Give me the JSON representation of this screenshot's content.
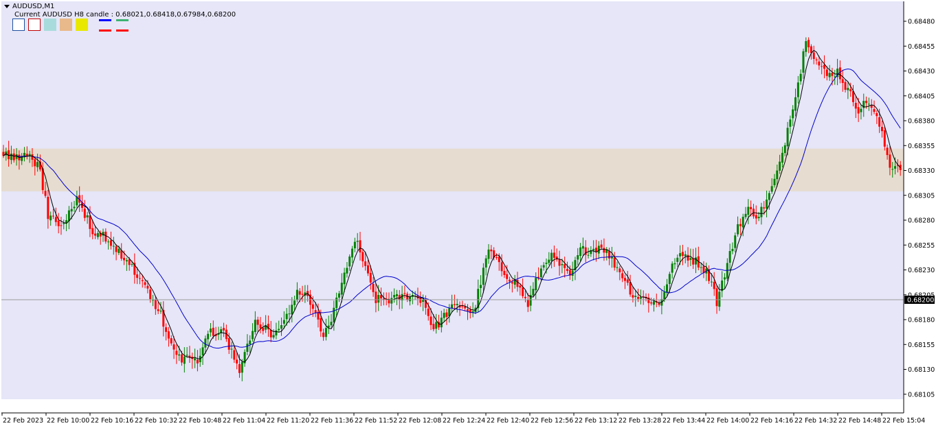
{
  "header": {
    "symbol_label": "AUDUSD,M1",
    "candle_info": "Current AUDUSD H8 candle : 0.68021,0.68418,0.67984,0.68200"
  },
  "toolbar_swatches": [
    {
      "name": "white-swatch",
      "fill": "#ffffff",
      "border": "#1f4f9f"
    },
    {
      "name": "red-outline-swatch",
      "fill": "#ffffff",
      "border": "#c00000"
    },
    {
      "name": "light-cyan-swatch",
      "fill": "#a8dcdc",
      "border": "#a8dcdc"
    },
    {
      "name": "tan-swatch",
      "fill": "#e8b98a",
      "border": "#e8b98a"
    },
    {
      "name": "yellow-swatch",
      "fill": "#e8e800",
      "border": "#e8e800"
    }
  ],
  "legend_line_colors": [
    "#0000ff",
    "#3cb371",
    "#ff0000",
    "#ff0000"
  ],
  "colors": {
    "background": "#e6e6f8",
    "zone_fill": "#e6dcd0",
    "bull": "#008000",
    "bear": "#ff0000",
    "ma_fast": "#000000",
    "ma_slow": "#0000cd",
    "current_price_line": "#9a9a9a",
    "price_tag_bg": "#000000"
  },
  "chart_data": {
    "type": "candlestick",
    "symbol": "AUDUSD",
    "timeframe": "M1",
    "ylim": [
      0.681,
      0.685
    ],
    "y_ticks": [
      "0.68480",
      "0.68455",
      "0.68430",
      "0.68405",
      "0.68380",
      "0.68355",
      "0.68330",
      "0.68305",
      "0.68280",
      "0.68255",
      "0.68230",
      "0.68205",
      "0.68180",
      "0.68155",
      "0.68130",
      "0.68105"
    ],
    "current_price": "0.68200",
    "zone": {
      "low": 0.68309,
      "high": 0.68352
    },
    "x_labels": [
      "22 Feb 2023",
      "22 Feb 10:00",
      "22 Feb 10:16",
      "22 Feb 10:32",
      "22 Feb 10:48",
      "22 Feb 11:04",
      "22 Feb 11:20",
      "22 Feb 11:36",
      "22 Feb 11:52",
      "22 Feb 12:08",
      "22 Feb 12:24",
      "22 Feb 12:40",
      "22 Feb 12:56",
      "22 Feb 13:12",
      "22 Feb 13:28",
      "22 Feb 13:44",
      "22 Feb 14:00",
      "22 Feb 14:16",
      "22 Feb 14:32",
      "22 Feb 14:48",
      "22 Feb 15:04"
    ],
    "close_path": [
      [
        0,
        0.68345
      ],
      [
        10,
        0.68345
      ],
      [
        14,
        0.6833
      ],
      [
        17,
        0.68285
      ],
      [
        22,
        0.68275
      ],
      [
        28,
        0.683
      ],
      [
        34,
        0.6827
      ],
      [
        40,
        0.68262
      ],
      [
        48,
        0.68235
      ],
      [
        55,
        0.6821
      ],
      [
        60,
        0.68185
      ],
      [
        66,
        0.6814
      ],
      [
        70,
        0.6814
      ],
      [
        74,
        0.6814
      ],
      [
        78,
        0.6817
      ],
      [
        84,
        0.68165
      ],
      [
        90,
        0.6813
      ],
      [
        96,
        0.6818
      ],
      [
        102,
        0.68165
      ],
      [
        106,
        0.6817
      ],
      [
        112,
        0.6821
      ],
      [
        118,
        0.68195
      ],
      [
        122,
        0.6816
      ],
      [
        128,
        0.68205
      ],
      [
        132,
        0.68245
      ],
      [
        135,
        0.68258
      ],
      [
        138,
        0.6823
      ],
      [
        142,
        0.682
      ],
      [
        148,
        0.682
      ],
      [
        155,
        0.68205
      ],
      [
        160,
        0.682
      ],
      [
        164,
        0.6817
      ],
      [
        170,
        0.6819
      ],
      [
        175,
        0.68195
      ],
      [
        179,
        0.68185
      ],
      [
        185,
        0.6825
      ],
      [
        190,
        0.6823
      ],
      [
        196,
        0.68215
      ],
      [
        200,
        0.68195
      ],
      [
        204,
        0.68225
      ],
      [
        208,
        0.68245
      ],
      [
        212,
        0.68235
      ],
      [
        216,
        0.68222
      ],
      [
        220,
        0.6825
      ],
      [
        224,
        0.6825
      ],
      [
        228,
        0.68255
      ],
      [
        236,
        0.68225
      ],
      [
        240,
        0.68205
      ],
      [
        246,
        0.682
      ],
      [
        250,
        0.68195
      ],
      [
        256,
        0.6824
      ],
      [
        260,
        0.68245
      ],
      [
        266,
        0.68235
      ],
      [
        270,
        0.6822
      ],
      [
        272,
        0.68198
      ],
      [
        276,
        0.68235
      ],
      [
        280,
        0.68275
      ],
      [
        284,
        0.6829
      ],
      [
        288,
        0.68285
      ],
      [
        292,
        0.68305
      ],
      [
        296,
        0.68335
      ],
      [
        300,
        0.68385
      ],
      [
        304,
        0.6843
      ],
      [
        306,
        0.68465
      ],
      [
        310,
        0.6844
      ],
      [
        314,
        0.68425
      ],
      [
        318,
        0.6843
      ],
      [
        322,
        0.6841
      ],
      [
        326,
        0.68392
      ],
      [
        330,
        0.684
      ],
      [
        334,
        0.68375
      ],
      [
        338,
        0.68335
      ],
      [
        342,
        0.68335
      ]
    ],
    "ma_periods": {
      "fast": 5,
      "slow": 20
    }
  }
}
